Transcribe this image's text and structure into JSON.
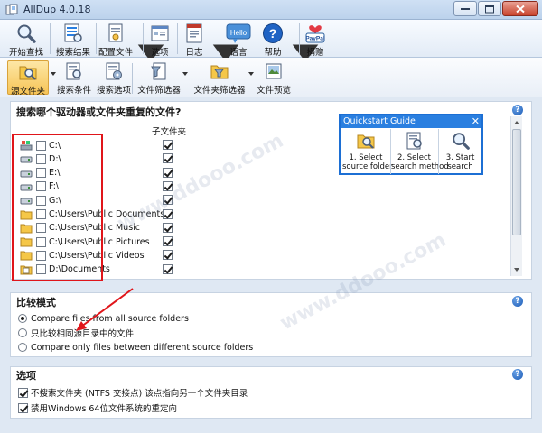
{
  "window": {
    "title": "AllDup 4.0.18"
  },
  "toolbar": {
    "items": [
      {
        "label": "开始查找",
        "icon": "magnifier-icon"
      },
      {
        "label": "搜索结果",
        "icon": "results-list-icon"
      },
      {
        "label": "配置文件",
        "icon": "profile-doc-icon"
      },
      {
        "label": "选项",
        "icon": "options-icon"
      },
      {
        "label": "日志",
        "icon": "log-icon"
      },
      {
        "label": "语言",
        "icon": "hello-bubble-icon",
        "icon_text": "Hello"
      },
      {
        "label": "帮助",
        "icon": "help-icon"
      },
      {
        "label": "捐赠",
        "icon": "paypal-icon",
        "icon_text": "PayPal"
      }
    ]
  },
  "toolbar2": {
    "items": [
      {
        "label": "源文件夹",
        "icon": "folder-magnifier-icon",
        "active": true
      },
      {
        "label": "搜索条件",
        "icon": "search-criteria-icon"
      },
      {
        "label": "搜索选项",
        "icon": "search-options-icon"
      },
      {
        "label": "文件筛选器",
        "icon": "file-filter-icon"
      },
      {
        "label": "文件夹筛选器",
        "icon": "folder-filter-icon"
      },
      {
        "label": "文件预览",
        "icon": "file-preview-icon"
      }
    ]
  },
  "source": {
    "title": "搜索哪个驱动器或文件夹重复的文件?",
    "subfolder_header": "子文件夹",
    "rows": [
      {
        "path": "C:\\",
        "kind": "system-drive",
        "checked": false,
        "subfolders": true
      },
      {
        "path": "D:\\",
        "kind": "drive",
        "checked": false,
        "subfolders": true
      },
      {
        "path": "E:\\",
        "kind": "drive",
        "checked": false,
        "subfolders": true
      },
      {
        "path": "F:\\",
        "kind": "drive",
        "checked": false,
        "subfolders": true
      },
      {
        "path": "G:\\",
        "kind": "drive",
        "checked": false,
        "subfolders": true
      },
      {
        "path": "C:\\Users\\Public Documents",
        "kind": "folder",
        "checked": false,
        "subfolders": true
      },
      {
        "path": "C:\\Users\\Public Music",
        "kind": "folder",
        "checked": false,
        "subfolders": true
      },
      {
        "path": "C:\\Users\\Public Pictures",
        "kind": "folder",
        "checked": false,
        "subfolders": true
      },
      {
        "path": "C:\\Users\\Public Videos",
        "kind": "folder",
        "checked": false,
        "subfolders": true
      },
      {
        "path": "D:\\Documents",
        "kind": "folder-doc",
        "checked": false,
        "subfolders": true
      }
    ]
  },
  "quickstart": {
    "title": "Quickstart Guide",
    "steps": [
      {
        "line1": "1. Select",
        "line2": "source folder"
      },
      {
        "line1": "2. Select",
        "line2": "search method"
      },
      {
        "line1": "3. Start",
        "line2": "search"
      }
    ]
  },
  "compare": {
    "title": "比较模式",
    "options": [
      {
        "label": "Compare files from all source folders",
        "selected": true
      },
      {
        "label": "只比较相同源目录中的文件",
        "selected": false
      },
      {
        "label": "Compare only files between different source folders",
        "selected": false
      }
    ]
  },
  "options": {
    "title": "选项",
    "items": [
      {
        "label": "不搜索文件夹 (NTFS 交接点) 该点指向另一个文件夹目录",
        "checked": true
      },
      {
        "label": "禁用Windows 64位文件系统的重定向",
        "checked": true
      }
    ]
  },
  "colors": {
    "accent": "#2a7fe0",
    "highlight_box": "#e0151a",
    "active_tab": "#f6c456"
  }
}
